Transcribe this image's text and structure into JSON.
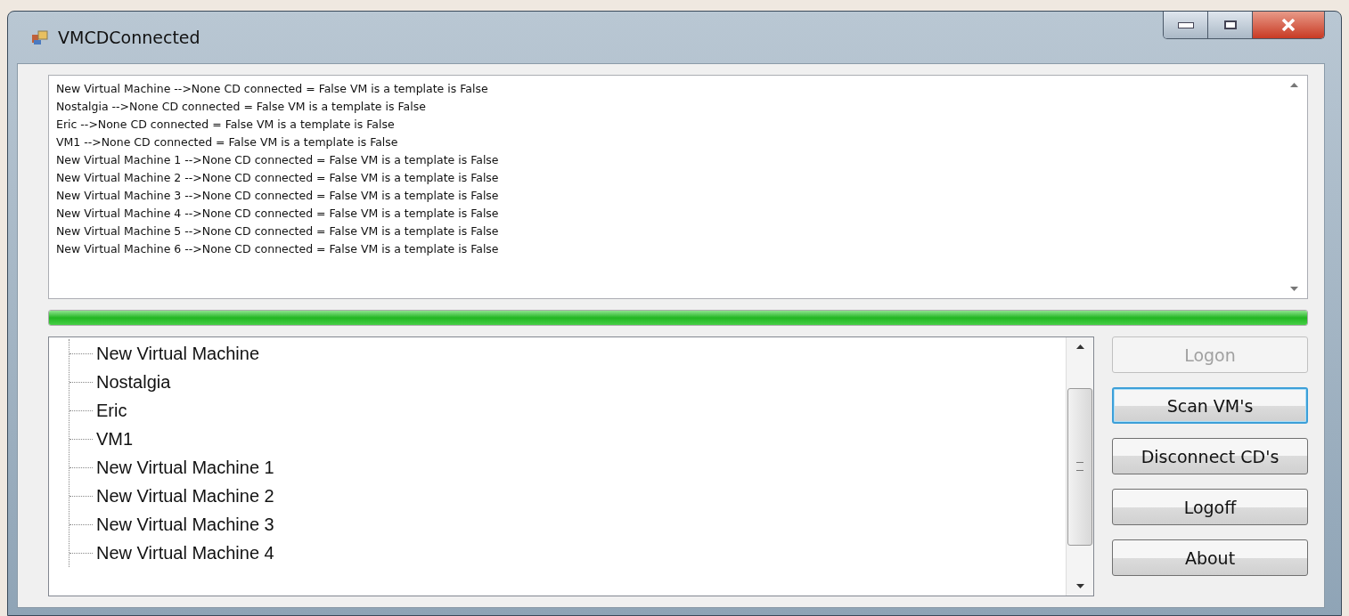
{
  "window": {
    "title": "VMCDConnected"
  },
  "log": {
    "lines": [
      "New Virtual Machine -->None CD connected = False VM is a template is False",
      "Nostalgia -->None CD connected = False VM is a template is False",
      "Eric -->None CD connected = False VM is a template is False",
      "VM1 -->None CD connected = False VM is a template is False",
      "New Virtual Machine 1 -->None CD connected = False VM is a template is False",
      "New Virtual Machine 2 -->None CD connected = False VM is a template is False",
      "New Virtual Machine 3 -->None CD connected = False VM is a template is False",
      "New Virtual Machine 4 -->None CD connected = False VM is a template is False",
      "New Virtual Machine 5 -->None CD connected = False VM is a template is False",
      "New Virtual Machine 6 -->None CD connected = False VM is a template is False"
    ]
  },
  "progress": {
    "level": 1
  },
  "tree": {
    "items": [
      {
        "label": "New Virtual Machine"
      },
      {
        "label": "Nostalgia"
      },
      {
        "label": "Eric"
      },
      {
        "label": "VM1"
      },
      {
        "label": "New Virtual Machine 1"
      },
      {
        "label": "New Virtual Machine 2"
      },
      {
        "label": "New Virtual Machine 3"
      },
      {
        "label": "New Virtual Machine 4"
      }
    ]
  },
  "buttons": [
    {
      "label": "Logon",
      "disabled": true,
      "focused": false
    },
    {
      "label": "Scan VM's",
      "disabled": false,
      "focused": true
    },
    {
      "label": "Disconnect CD's",
      "disabled": false,
      "focused": false
    },
    {
      "label": "Logoff",
      "disabled": false,
      "focused": false
    },
    {
      "label": "About",
      "disabled": false,
      "focused": false
    }
  ]
}
